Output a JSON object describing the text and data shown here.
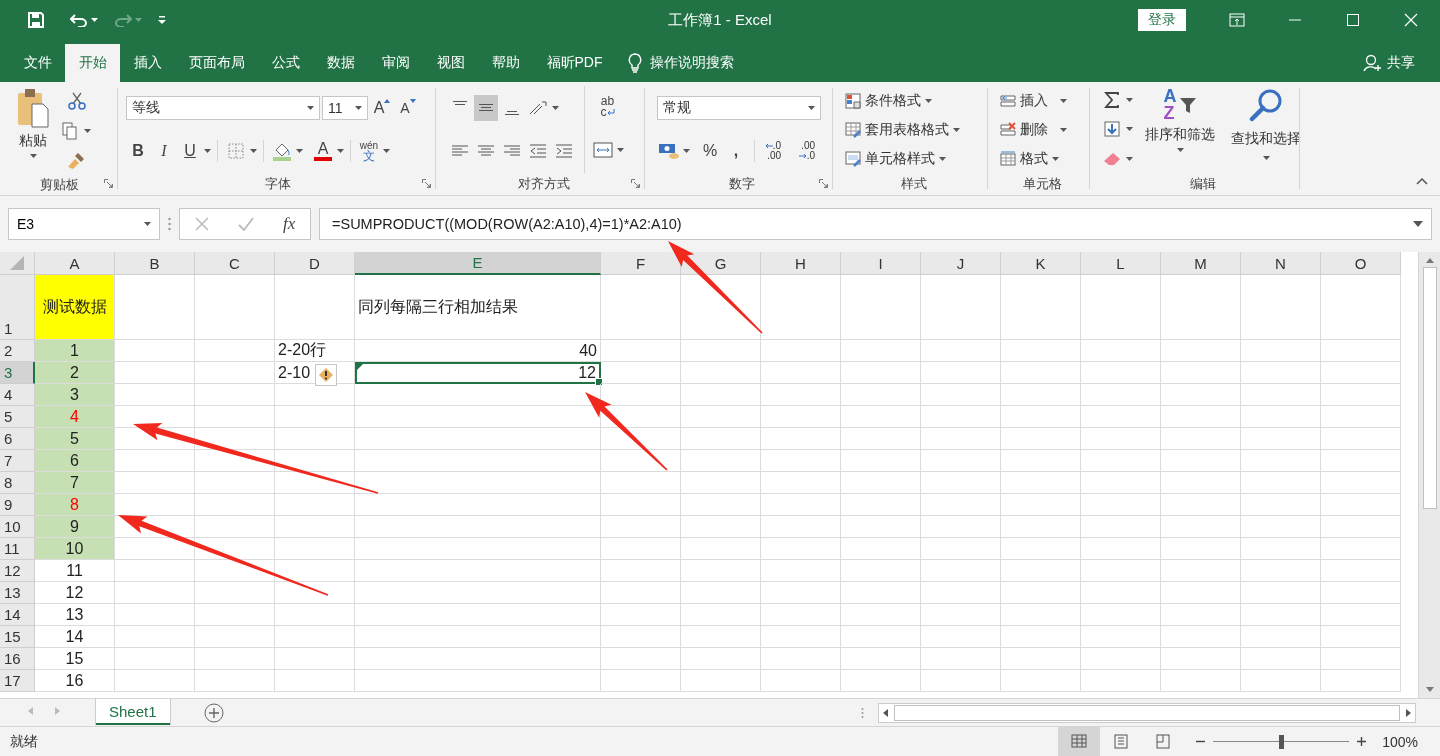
{
  "title_bar": {
    "title": "工作簿1  -  Excel",
    "login": "登录"
  },
  "ribbon_tabs": [
    {
      "label": "文件",
      "selected": false
    },
    {
      "label": "开始",
      "selected": true
    },
    {
      "label": "插入",
      "selected": false
    },
    {
      "label": "页面布局",
      "selected": false
    },
    {
      "label": "公式",
      "selected": false
    },
    {
      "label": "数据",
      "selected": false
    },
    {
      "label": "审阅",
      "selected": false
    },
    {
      "label": "视图",
      "selected": false
    },
    {
      "label": "帮助",
      "selected": false
    },
    {
      "label": "福昕PDF",
      "selected": false
    }
  ],
  "tell_me": "操作说明搜索",
  "share": "共享",
  "ribbon": {
    "clipboard": {
      "label": "剪贴板",
      "paste": "粘贴"
    },
    "font": {
      "label": "字体",
      "font_name": "等线",
      "font_size": "11",
      "grow": "A",
      "shrink": "A",
      "bold": "B",
      "italic": "I",
      "underline": "U",
      "font_color": "A",
      "phonetic": {
        "pinyin": "wén",
        "char": "文"
      }
    },
    "alignment": {
      "label": "对齐方式",
      "vertical_align": [
        {
          "selected": false
        },
        {
          "selected": true
        },
        {
          "selected": false
        }
      ],
      "wrap_text": [
        "ab",
        "c"
      ]
    },
    "number": {
      "label": "数字",
      "format": "常规",
      "percent": "%",
      "comma": ",",
      "increase_decimal": [
        ".0",
        ".00"
      ],
      "decrease_decimal": [
        ".00",
        ".0"
      ]
    },
    "styles": {
      "label": "样式",
      "items": [
        "条件格式",
        "套用表格格式",
        "单元格样式"
      ]
    },
    "cells": {
      "label": "单元格",
      "items": [
        "插入",
        "删除",
        "格式"
      ]
    },
    "editing": {
      "label": "编辑",
      "sort": {
        "label": "排序和筛选",
        "letters": [
          "A",
          "Z"
        ]
      },
      "find": "查找和选择"
    }
  },
  "formula_bar": {
    "name_box": "E3",
    "fx": "fx",
    "formula": "=SUMPRODUCT((MOD(ROW(A2:A10),4)=1)*A2:A10)"
  },
  "sheet": {
    "columns": [
      {
        "label": "A",
        "selected": false
      },
      {
        "label": "B",
        "selected": false
      },
      {
        "label": "C",
        "selected": false
      },
      {
        "label": "D",
        "selected": false
      },
      {
        "label": "E",
        "selected": true
      },
      {
        "label": "F",
        "selected": false
      },
      {
        "label": "G",
        "selected": false
      },
      {
        "label": "H",
        "selected": false
      },
      {
        "label": "I",
        "selected": false
      },
      {
        "label": "J",
        "selected": false
      },
      {
        "label": "K",
        "selected": false
      },
      {
        "label": "L",
        "selected": false
      },
      {
        "label": "M",
        "selected": false
      },
      {
        "label": "N",
        "selected": false
      },
      {
        "label": "O",
        "selected": false
      }
    ],
    "rows": [
      {
        "header": "1",
        "selected": false,
        "cells": {
          "A": {
            "text": "测试数据",
            "kind": "title",
            "color": "#ffff00",
            "selected": false
          },
          "E": {
            "text": "同列每隔三行相加结果",
            "kind": "text",
            "selected": false
          }
        }
      },
      {
        "header": "2",
        "selected": false,
        "cells": {
          "A": {
            "text": "1",
            "kind": "value",
            "color": "#c6e0b4",
            "selected": false
          },
          "D": {
            "text": "2-20行",
            "kind": "text",
            "selected": false
          },
          "E": {
            "text": "40",
            "kind": "number",
            "selected": false
          }
        }
      },
      {
        "header": "3",
        "selected": true,
        "cells": {
          "A": {
            "text": "2",
            "kind": "value",
            "color": "#c6e0b4",
            "selected": false
          },
          "D": {
            "text": "2-10",
            "kind": "text",
            "selected": false
          },
          "E": {
            "text": "12",
            "kind": "number",
            "selected": true,
            "error_indicator": true
          }
        }
      },
      {
        "header": "4",
        "selected": false,
        "cells": {
          "A": {
            "text": "3",
            "kind": "value",
            "color": "#c6e0b4",
            "selected": false
          }
        }
      },
      {
        "header": "5",
        "selected": false,
        "cells": {
          "A": {
            "text": "4",
            "kind": "marked",
            "color": "#c6e0b4",
            "selected": false
          }
        }
      },
      {
        "header": "6",
        "selected": false,
        "cells": {
          "A": {
            "text": "5",
            "kind": "value",
            "color": "#c6e0b4",
            "selected": false
          }
        }
      },
      {
        "header": "7",
        "selected": false,
        "cells": {
          "A": {
            "text": "6",
            "kind": "value",
            "color": "#c6e0b4",
            "selected": false
          }
        }
      },
      {
        "header": "8",
        "selected": false,
        "cells": {
          "A": {
            "text": "7",
            "kind": "value",
            "color": "#c6e0b4",
            "selected": false
          }
        }
      },
      {
        "header": "9",
        "selected": false,
        "cells": {
          "A": {
            "text": "8",
            "kind": "marked",
            "color": "#c6e0b4",
            "selected": false
          }
        }
      },
      {
        "header": "10",
        "selected": false,
        "cells": {
          "A": {
            "text": "9",
            "kind": "value",
            "color": "#c6e0b4",
            "selected": false
          }
        }
      },
      {
        "header": "11",
        "selected": false,
        "cells": {
          "A": {
            "text": "10",
            "kind": "value",
            "color": "#c6e0b4",
            "selected": false
          }
        }
      },
      {
        "header": "12",
        "selected": false,
        "cells": {
          "A": {
            "text": "11",
            "kind": "value",
            "selected": false
          }
        }
      },
      {
        "header": "13",
        "selected": false,
        "cells": {
          "A": {
            "text": "12",
            "kind": "value",
            "selected": false
          }
        }
      },
      {
        "header": "14",
        "selected": false,
        "cells": {
          "A": {
            "text": "13",
            "kind": "value",
            "selected": false
          }
        }
      },
      {
        "header": "15",
        "selected": false,
        "cells": {
          "A": {
            "text": "14",
            "kind": "value",
            "selected": false
          }
        }
      },
      {
        "header": "16",
        "selected": false,
        "cells": {
          "A": {
            "text": "15",
            "kind": "value",
            "selected": false
          }
        }
      },
      {
        "header": "17",
        "selected": false,
        "cells": {
          "A": {
            "text": "16",
            "kind": "value",
            "selected": false
          }
        }
      }
    ]
  },
  "sheet_tabs": [
    {
      "label": "Sheet1",
      "selected": true
    }
  ],
  "status_bar": {
    "status": "就绪",
    "view_modes": [
      {
        "selected": true
      },
      {
        "selected": false
      },
      {
        "selected": false
      }
    ],
    "zoom_slider": {
      "level": 0.5
    },
    "zoom": "100%"
  }
}
